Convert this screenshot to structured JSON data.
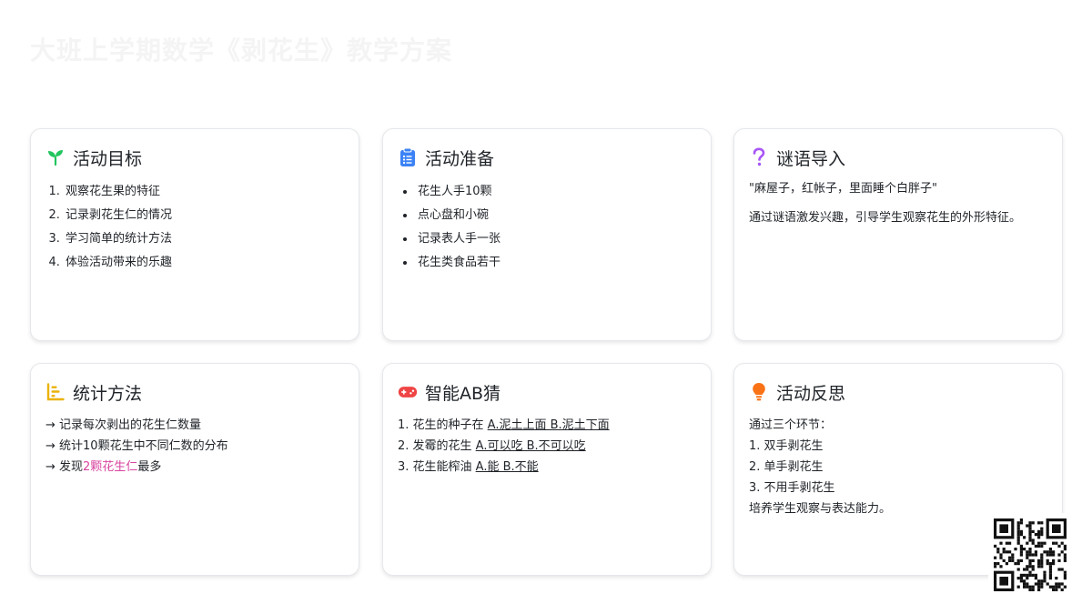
{
  "page": {
    "title": "大班上学期数学《剥花生》教学方案"
  },
  "cards": {
    "goals": {
      "title": "活动目标",
      "icon": "sprout-icon",
      "items": [
        "观察花生果的特征",
        "记录剥花生仁的情况",
        "学习简单的统计方法",
        "体验活动带来的乐趣"
      ]
    },
    "prep": {
      "title": "活动准备",
      "icon": "clipboard-icon",
      "items": [
        "花生人手10颗",
        "点心盘和小碗",
        "记录表人手一张",
        "花生类食品若干"
      ]
    },
    "riddle": {
      "title": "谜语导入",
      "icon": "question-icon",
      "quote": "\"麻屋子，红帐子，里面睡个白胖子\"",
      "desc": "通过谜语激发兴趣，引导学生观察花生的外形特征。"
    },
    "stats": {
      "title": "统计方法",
      "icon": "bar-chart-icon",
      "line1": "→ 记录每次剥出的花生仁数量",
      "line2": "→ 统计10颗花生中不同仁数的分布",
      "line3_prefix": "→ 发现",
      "line3_highlight": "2颗花生仁",
      "line3_suffix": "最多"
    },
    "game": {
      "title": "智能AB猜",
      "icon": "gamepad-icon",
      "q1_text": "1. 花生的种子在 ",
      "q1_options": "A.泥土上面 B.泥土下面",
      "q2_text": "2. 发霉的花生 ",
      "q2_options": "A.可以吃 B.不可以吃",
      "q3_text": "3. 花生能榨油 ",
      "q3_options": "A.能 B.不能"
    },
    "reflection": {
      "title": "活动反思",
      "icon": "lightbulb-icon",
      "lines": [
        "通过三个环节：",
        "1. 双手剥花生",
        "2. 单手剥花生",
        "3. 不用手剥花生",
        "培养学生观察与表达能力。"
      ]
    }
  },
  "colors": {
    "sprout": "#22c55e",
    "clipboard": "#3b82f6",
    "question": "#a855f7",
    "chart": "#eab308",
    "gamepad": "#ef4444",
    "bulb": "#f97316",
    "highlight": "#d946a0"
  },
  "qr_code": {
    "icon": "qr-code-icon"
  }
}
